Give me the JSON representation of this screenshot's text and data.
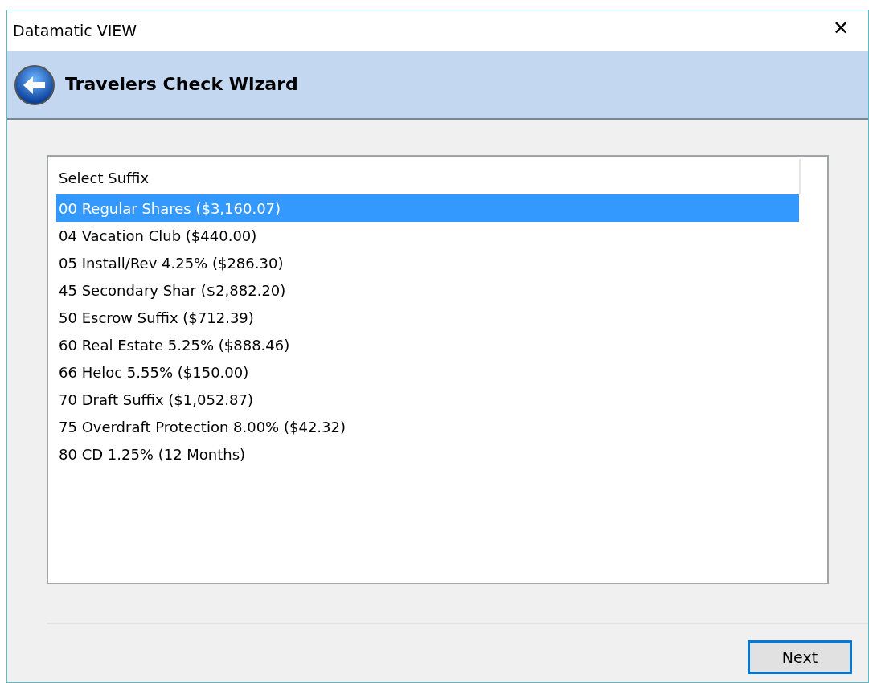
{
  "window": {
    "title": "Datamatic VIEW",
    "close": "✕"
  },
  "header": {
    "title": "Travelers Check Wizard"
  },
  "list": {
    "column": "Select Suffix",
    "items": [
      {
        "text": "00 Regular Shares ($3,160.07)",
        "selected": true
      },
      {
        "text": "04 Vacation Club ($440.00)",
        "selected": false
      },
      {
        "text": "05 Install/Rev 4.25% ($286.30)",
        "selected": false
      },
      {
        "text": "45 Secondary Shar ($2,882.20)",
        "selected": false
      },
      {
        "text": "50 Escrow Suffix ($712.39)",
        "selected": false
      },
      {
        "text": "60 Real Estate 5.25% ($888.46)",
        "selected": false
      },
      {
        "text": "66 Heloc 5.55% ($150.00)",
        "selected": false
      },
      {
        "text": "70 Draft Suffix ($1,052.87)",
        "selected": false
      },
      {
        "text": "75 Overdraft Protection 8.00% ($42.32)",
        "selected": false
      },
      {
        "text": "80 CD 1.25% (12 Months)",
        "selected": false
      }
    ]
  },
  "buttons": [
    {
      "label": "Next"
    }
  ]
}
